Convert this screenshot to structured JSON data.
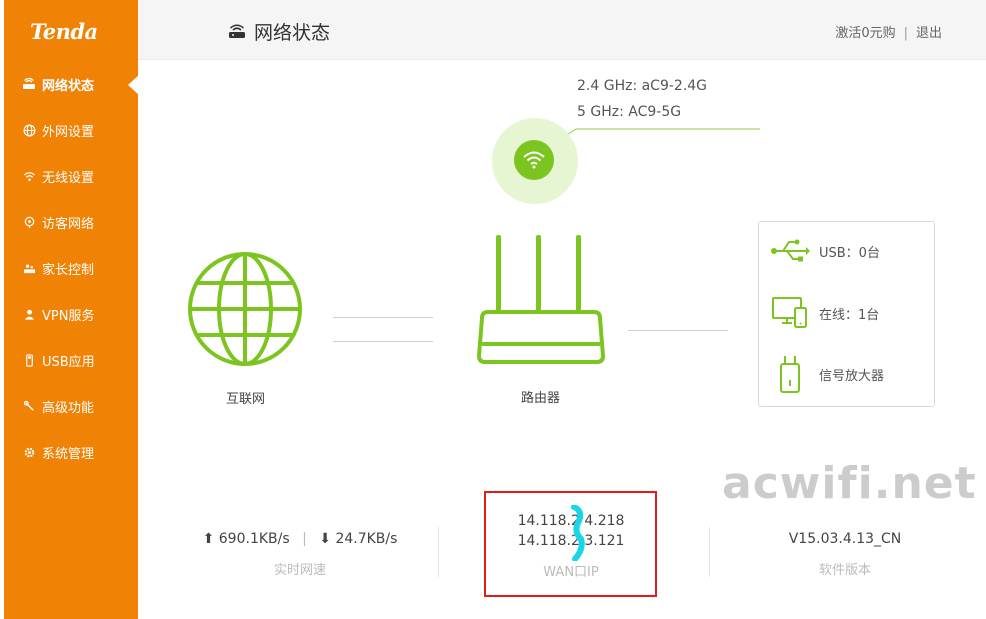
{
  "brand": {
    "logo": "Tenda",
    "accent": "#f08205",
    "green": "#7cc520"
  },
  "sidebar": {
    "items": [
      {
        "label": "网络状态",
        "icon": "router-icon",
        "active": true
      },
      {
        "label": "外网设置",
        "icon": "globe-icon",
        "active": false
      },
      {
        "label": "无线设置",
        "icon": "wifi-icon",
        "active": false
      },
      {
        "label": "访客网络",
        "icon": "guest-icon",
        "active": false
      },
      {
        "label": "家长控制",
        "icon": "parental-icon",
        "active": false
      },
      {
        "label": "VPN服务",
        "icon": "vpn-icon",
        "active": false
      },
      {
        "label": "USB应用",
        "icon": "usb-icon",
        "active": false
      },
      {
        "label": "高级功能",
        "icon": "wrench-icon",
        "active": false
      },
      {
        "label": "系统管理",
        "icon": "gear-icon",
        "active": false
      }
    ]
  },
  "header": {
    "title": "网络状态",
    "promo_link": "激活0元购",
    "separator": "|",
    "logout_link": "退出"
  },
  "wifi": {
    "ssid_24": "2.4 GHz: aC9-2.4G",
    "ssid_5": "5 GHz: AC9-5G"
  },
  "diagram": {
    "internet_label": "互联网",
    "router_label": "路由器"
  },
  "devices": {
    "usb": "USB：0台",
    "online": "在线：1台",
    "extender": "信号放大器"
  },
  "watermark": "acwifi.net",
  "stats": {
    "upload": "690.1KB/s",
    "download": "24.7KB/s",
    "speed_separator": "|",
    "speed_caption": "实时网速",
    "wan_ip_1": "14.118.2  4.218",
    "wan_ip_2": "14.118.2  3.121",
    "wan_caption": "WAN口IP",
    "version": "V15.03.4.13_CN",
    "version_caption": "软件版本"
  }
}
